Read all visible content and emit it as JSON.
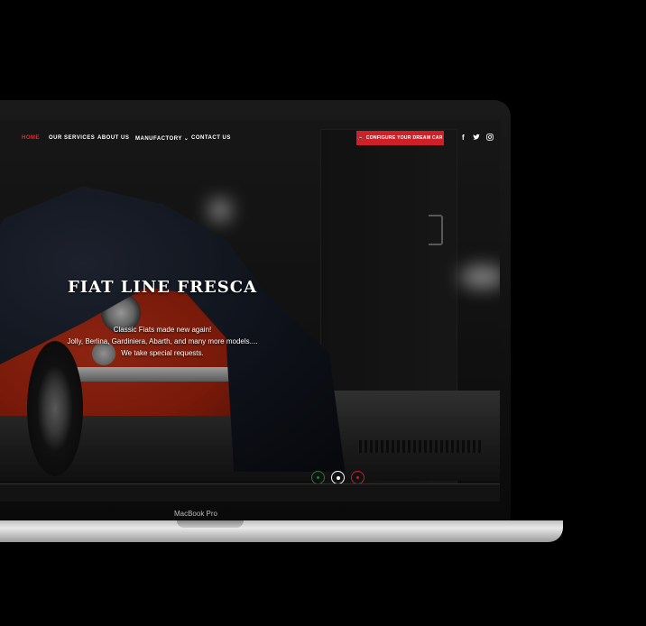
{
  "nav": {
    "items": [
      "HOME",
      "OUR SERVICES",
      "ABOUT US",
      "MANUFACTORY",
      "CONTACT US"
    ],
    "active_index": 0,
    "dropdown_icon": "chevron-down-icon"
  },
  "cta": {
    "label": "CONFIGURE YOUR DREAM CAR",
    "icon": "car-icon"
  },
  "social": [
    {
      "icon": "facebook-icon",
      "glyph": "f"
    },
    {
      "icon": "twitter-icon",
      "glyph": "🐦"
    },
    {
      "icon": "instagram-icon",
      "glyph": "◎"
    }
  ],
  "hero": {
    "title": "FIAT LINE FRESCA",
    "line1": "Classic Fiats made new again!",
    "line2": "Jolly, Berlina, Gardiniera, Abarth, and many more models....",
    "line3": "We take special requests."
  },
  "slider": {
    "dots": [
      {
        "name": "slider-dot-green",
        "color": "#1f7a3b"
      },
      {
        "name": "slider-dot-white",
        "color": "#ffffff"
      },
      {
        "name": "slider-dot-red",
        "color": "#c0202a"
      }
    ],
    "active_index": 1
  },
  "device": {
    "label": "MacBook Pro"
  },
  "colors": {
    "accent": "#e02a32",
    "cta": "#cf2028"
  }
}
